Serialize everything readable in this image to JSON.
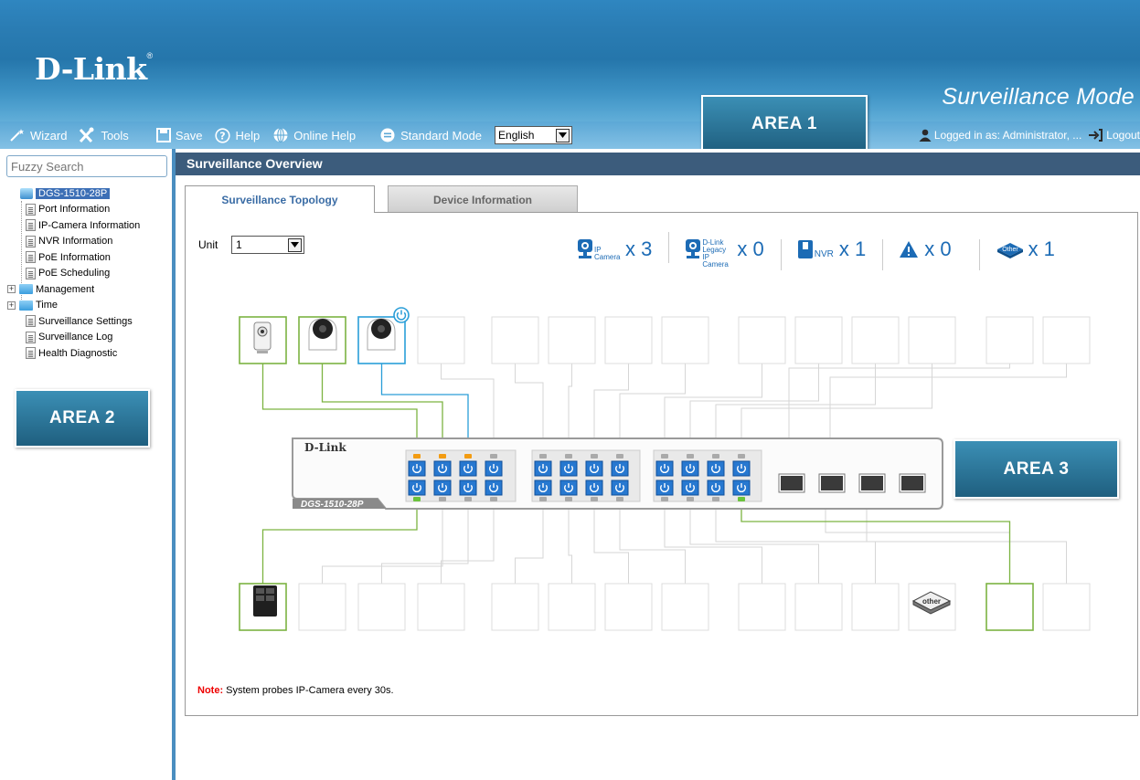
{
  "header": {
    "logo": "D-Link",
    "mode_title": "Surveillance Mode",
    "toolbar": {
      "wizard": "Wizard",
      "tools": "Tools",
      "save": "Save",
      "help": "Help",
      "online_help": "Online Help",
      "standard_mode": "Standard Mode",
      "language": "English"
    },
    "login": {
      "text": "Logged in as:  Administrator, ...",
      "logout": "Logout"
    }
  },
  "callouts": {
    "area1": "AREA 1",
    "area2": "AREA 2",
    "area3": "AREA 3"
  },
  "sidebar": {
    "search_placeholder": "Fuzzy Search",
    "items": [
      {
        "label": "DGS-1510-28P",
        "icon": "switch-icon",
        "selected": true
      },
      {
        "label": "Port Information",
        "icon": "document-icon"
      },
      {
        "label": "IP-Camera Information",
        "icon": "document-icon"
      },
      {
        "label": "NVR Information",
        "icon": "document-icon"
      },
      {
        "label": "PoE Information",
        "icon": "document-icon"
      },
      {
        "label": "PoE Scheduling",
        "icon": "document-icon"
      },
      {
        "label": "Management",
        "icon": "folder-icon",
        "expandable": true
      },
      {
        "label": "Time",
        "icon": "folder-icon",
        "expandable": true
      },
      {
        "label": "Surveillance Settings",
        "icon": "document-icon"
      },
      {
        "label": "Surveillance Log",
        "icon": "document-icon"
      },
      {
        "label": "Health Diagnostic",
        "icon": "document-icon"
      }
    ]
  },
  "main": {
    "title": "Surveillance Overview",
    "tabs": [
      {
        "label": "Surveillance Topology",
        "active": true
      },
      {
        "label": "Device Information",
        "active": false
      }
    ],
    "unit_label": "Unit",
    "unit_value": "1",
    "counters": [
      {
        "icon": "ip-camera-icon",
        "label": "IP Camera",
        "text": "x 3"
      },
      {
        "icon": "legacy-camera-icon",
        "label": "D-Link Legacy IP Camera",
        "text": "x 0"
      },
      {
        "icon": "nvr-icon",
        "label": "NVR",
        "text": "x 1"
      },
      {
        "icon": "warning-icon",
        "label": "",
        "text": "x 0"
      },
      {
        "icon": "other-device-icon",
        "label": "Other",
        "text": "x 1"
      }
    ],
    "switch": {
      "brand": "D-Link",
      "model": "DGS-1510-28P"
    },
    "other_label": "other",
    "note_label": "Note:",
    "note_text": " System probes IP-Camera every 30s."
  },
  "colors": {
    "connected": "#7cb342",
    "powered": "#2a9ed8",
    "title_bar": "#3c5c7c",
    "port_blue": "#2778d0"
  }
}
